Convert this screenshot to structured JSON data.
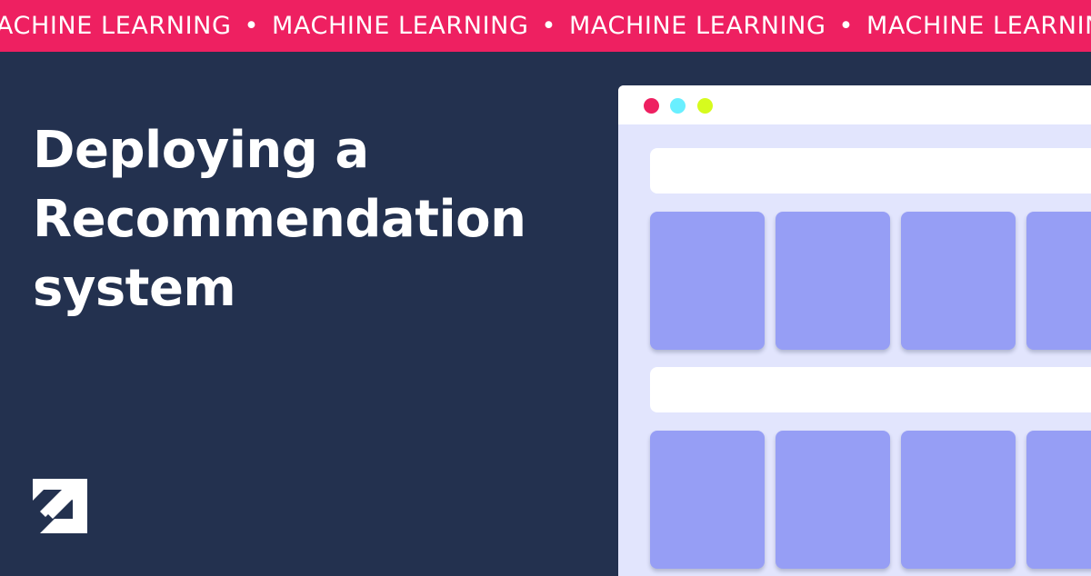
{
  "banner": {
    "segments": [
      "MACHINE LEARNING",
      "MACHINE LEARNING",
      "MACHINE LEARNING",
      "MACHINE LEARNING"
    ],
    "separator": "•",
    "background_color": "#ee2061",
    "text_color": "#ffffff"
  },
  "headline": {
    "lines": [
      "Deploying a",
      "Recommendation",
      "system"
    ],
    "color": "#ffffff"
  },
  "logo": {
    "icon": "arrow-up-right-icon",
    "color": "#ffffff"
  },
  "browser_mockup": {
    "window_dots": [
      {
        "name": "red",
        "color": "#ee2061"
      },
      {
        "name": "cyan",
        "color": "#69efff"
      },
      {
        "name": "lime",
        "color": "#d6fb1e"
      }
    ],
    "content_background": "#e2e5fd",
    "card_color": "#969ef5",
    "rows": 2,
    "cards_per_row": 4
  },
  "page_background": "#23314f"
}
